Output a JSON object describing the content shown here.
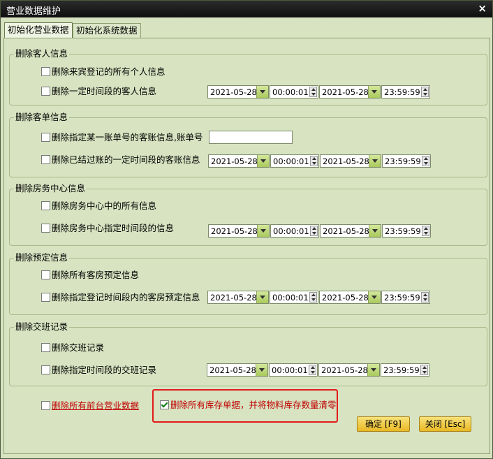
{
  "window": {
    "title": "营业数据维护",
    "close_glyph": "×"
  },
  "tabs": [
    {
      "label": "初始化营业数据",
      "active": true
    },
    {
      "label": "初始化系统数据",
      "active": false
    }
  ],
  "groups": {
    "guest": {
      "legend": "删除客人信息",
      "rows": [
        {
          "label": "删除来宾登记的所有个人信息",
          "checked": false
        },
        {
          "label": "删除一定时间段的客人信息",
          "checked": false,
          "start_date": "2021-05-28",
          "start_time": "00:00:01",
          "end_date": "2021-05-28",
          "end_time": "23:59:59"
        }
      ]
    },
    "bill": {
      "legend": "删除客单信息",
      "rows": [
        {
          "label": "删除指定某一账单号的客账信息,账单号",
          "checked": false,
          "bill_no": ""
        },
        {
          "label": "删除已结过账的一定时间段的客账信息",
          "checked": false,
          "start_date": "2021-05-28",
          "start_time": "00:00:01",
          "end_date": "2021-05-28",
          "end_time": "23:59:59"
        }
      ]
    },
    "housekeeping": {
      "legend": "删除房务中心信息",
      "rows": [
        {
          "label": "删除房务中心中的所有信息",
          "checked": false
        },
        {
          "label": "删除房务中心指定时间段的信息",
          "checked": false,
          "start_date": "2021-05-28",
          "start_time": "00:00:01",
          "end_date": "2021-05-28",
          "end_time": "23:59:59"
        }
      ]
    },
    "reservation": {
      "legend": "删除预定信息",
      "rows": [
        {
          "label": "删除所有客房预定信息",
          "checked": false
        },
        {
          "label": "删除指定登记时间段内的客房预定信息",
          "checked": false,
          "start_date": "2021-05-28",
          "start_time": "00:00:01",
          "end_date": "2021-05-28",
          "end_time": "23:59:59"
        }
      ]
    },
    "shift": {
      "legend": "删除交班记录",
      "rows": [
        {
          "label": "删除交班记录",
          "checked": false
        },
        {
          "label": "删除指定时间段的交班记录",
          "checked": false,
          "start_date": "2021-05-28",
          "start_time": "00:00:01",
          "end_date": "2021-05-28",
          "end_time": "23:59:59"
        }
      ]
    }
  },
  "bottom": {
    "delete_all_frontdesk": {
      "label": "删除所有前台营业数据",
      "checked": false
    },
    "delete_inventory": {
      "label": "删除所有库存单据，并将物料库存数量清零",
      "checked": true
    }
  },
  "buttons": {
    "confirm": "确定 [F9]",
    "close": "关闭 [Esc]"
  },
  "colors": {
    "highlight_border": "#e21b1b",
    "warning_text": "#c00000",
    "button_fill": "#f2cf4c"
  }
}
